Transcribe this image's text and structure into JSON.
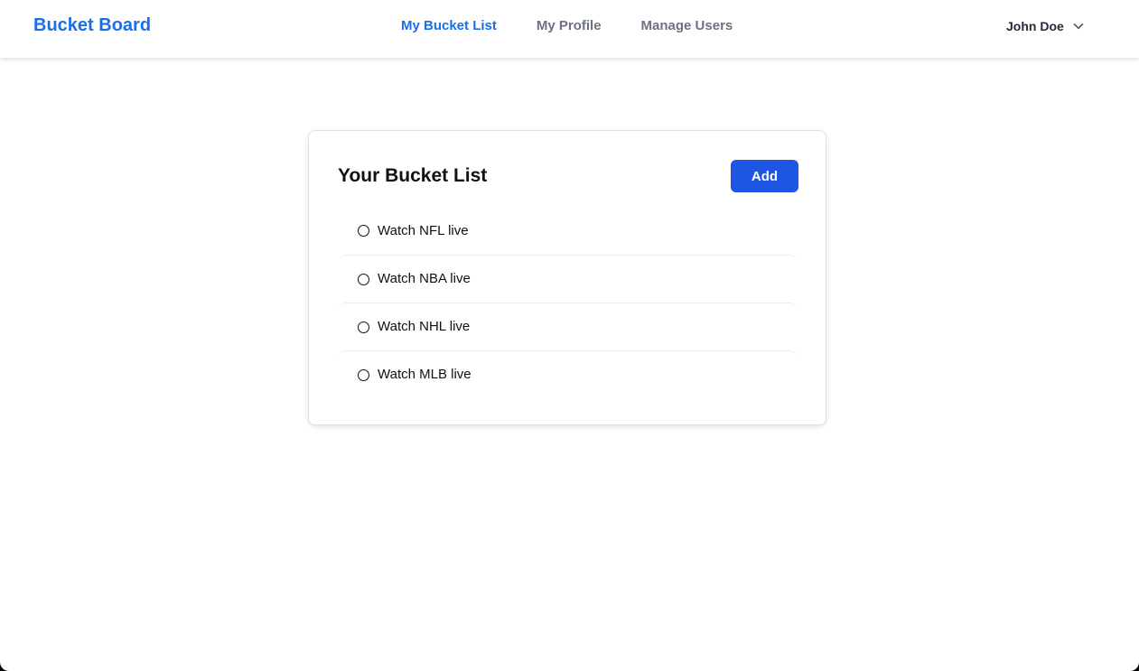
{
  "app": {
    "brand": "Bucket Board"
  },
  "nav": {
    "links": [
      {
        "label": "My Bucket List",
        "active": true
      },
      {
        "label": "My Profile",
        "active": false
      },
      {
        "label": "Manage Users",
        "active": false
      }
    ]
  },
  "user": {
    "name": "John Doe",
    "menu_icon": "chevron-down-icon"
  },
  "bucket_list": {
    "title": "Your Bucket List",
    "add_label": "Add",
    "items": [
      {
        "label": "Watch NFL live",
        "completed": false
      },
      {
        "label": "Watch NBA live",
        "completed": false
      },
      {
        "label": "Watch NHL live",
        "completed": false
      },
      {
        "label": "Watch MLB live",
        "completed": false
      }
    ]
  },
  "colors": {
    "brand": "#1a6fe8",
    "button": "#1d55e4",
    "nav_inactive": "#6b7280"
  }
}
